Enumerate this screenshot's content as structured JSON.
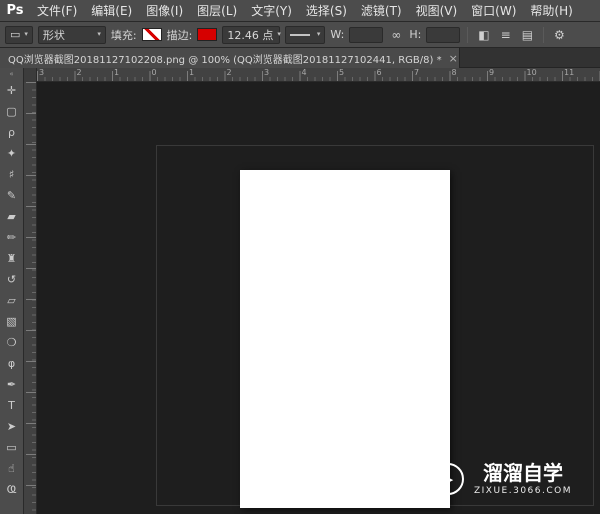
{
  "app": {
    "logo": "Ps"
  },
  "menu_bar": {
    "items": [
      "文件(F)",
      "编辑(E)",
      "图像(I)",
      "图层(L)",
      "文字(Y)",
      "选择(S)",
      "滤镜(T)",
      "视图(V)",
      "窗口(W)",
      "帮助(H)"
    ]
  },
  "options_bar": {
    "tool_preset_glyph": "▭",
    "tool_mode": "形状",
    "fill_label": "填充:",
    "stroke_label": "描边:",
    "stroke_width_value": "12.46 点",
    "w_label": "W:",
    "w_value": "",
    "h_label": "H:",
    "h_value": "",
    "link_icon": "∞",
    "path_operations_icon": "◧",
    "path_alignment_icon": "≡",
    "path_arrange_icon": "▤",
    "settings_icon": "⚙",
    "colors": {
      "stroke_swatch": "#d60000",
      "fill_none_stripe": "#d60000",
      "ui_background": "#4c4c4c",
      "canvas_background": "#1e1e1e"
    }
  },
  "document_tabs": {
    "active_title": "QQ浏览器截图20181127102208.png @ 100% (QQ浏览器截图20181127102441, RGB/8) *",
    "close_glyph": "×"
  },
  "rulers": {
    "horizontal": [
      "3",
      "2",
      "1",
      "0",
      "1",
      "2",
      "3",
      "4",
      "5",
      "6",
      "7",
      "8",
      "9",
      "10",
      "11"
    ],
    "vertical": [
      "3",
      "2",
      "1",
      "0",
      "1",
      "2",
      "3",
      "4",
      "5",
      "6",
      "7",
      "8",
      "9",
      "10"
    ]
  },
  "toolbar": {
    "collapse_glyph": "«",
    "tools": [
      {
        "name": "move",
        "glyph": "✛"
      },
      {
        "name": "rectangular-marquee",
        "glyph": "▢"
      },
      {
        "name": "lasso",
        "glyph": "ρ"
      },
      {
        "name": "quick-selection",
        "glyph": "✦"
      },
      {
        "name": "crop",
        "glyph": "♯"
      },
      {
        "name": "eyedropper",
        "glyph": "✎"
      },
      {
        "name": "spot-healing-brush",
        "glyph": "▰"
      },
      {
        "name": "brush",
        "glyph": "✏"
      },
      {
        "name": "clone-stamp",
        "glyph": "♜"
      },
      {
        "name": "history-brush",
        "glyph": "↺"
      },
      {
        "name": "eraser",
        "glyph": "▱"
      },
      {
        "name": "gradient",
        "glyph": "▧"
      },
      {
        "name": "blur",
        "glyph": "❍"
      },
      {
        "name": "dodge",
        "glyph": "φ"
      },
      {
        "name": "pen",
        "glyph": "✒"
      },
      {
        "name": "type",
        "glyph": "T"
      },
      {
        "name": "path-selection",
        "glyph": "➤"
      },
      {
        "name": "rectangle",
        "glyph": "▭"
      },
      {
        "name": "hand",
        "glyph": "☝"
      },
      {
        "name": "zoom",
        "glyph": "Ҩ"
      }
    ]
  },
  "watermark": {
    "play_icon": "▶",
    "title": "溜溜自学",
    "subtitle": "ZIXUE.3066.COM"
  }
}
